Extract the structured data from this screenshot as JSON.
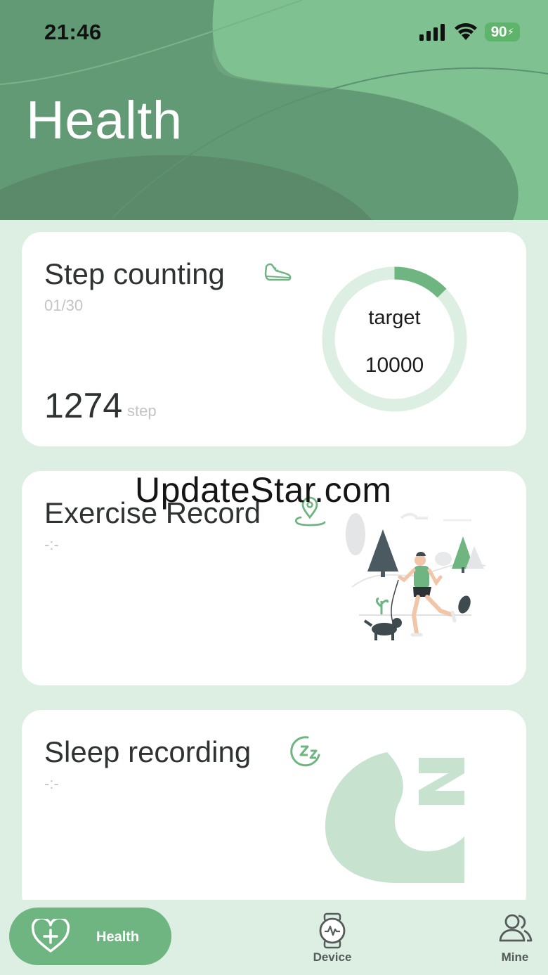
{
  "status_bar": {
    "time": "21:46",
    "battery": "90",
    "icons": [
      "cellular-signal-icon",
      "wifi-icon",
      "battery-charging-icon"
    ]
  },
  "header": {
    "title": "Health"
  },
  "step_card": {
    "title": "Step counting",
    "date": "01/30",
    "steps": "1274",
    "unit": "step",
    "target_label": "target",
    "target_value": "10000",
    "progress_fraction": 0.1274,
    "icon": "shoe-icon"
  },
  "exercise_card": {
    "title": "Exercise Record",
    "value": "-:-",
    "icon": "location-pin-icon"
  },
  "sleep_card": {
    "title": "Sleep recording",
    "value": "-:-",
    "icon": "zz-sleep-icon"
  },
  "watermark": "UpdateStar.com",
  "tab_bar": {
    "health": "Health",
    "device": "Device",
    "mine": "Mine"
  },
  "colors": {
    "accent": "#6fb582",
    "accent_light": "#dcefe2",
    "header_dark": "#5c8e6e",
    "header_light": "#7fc090"
  }
}
